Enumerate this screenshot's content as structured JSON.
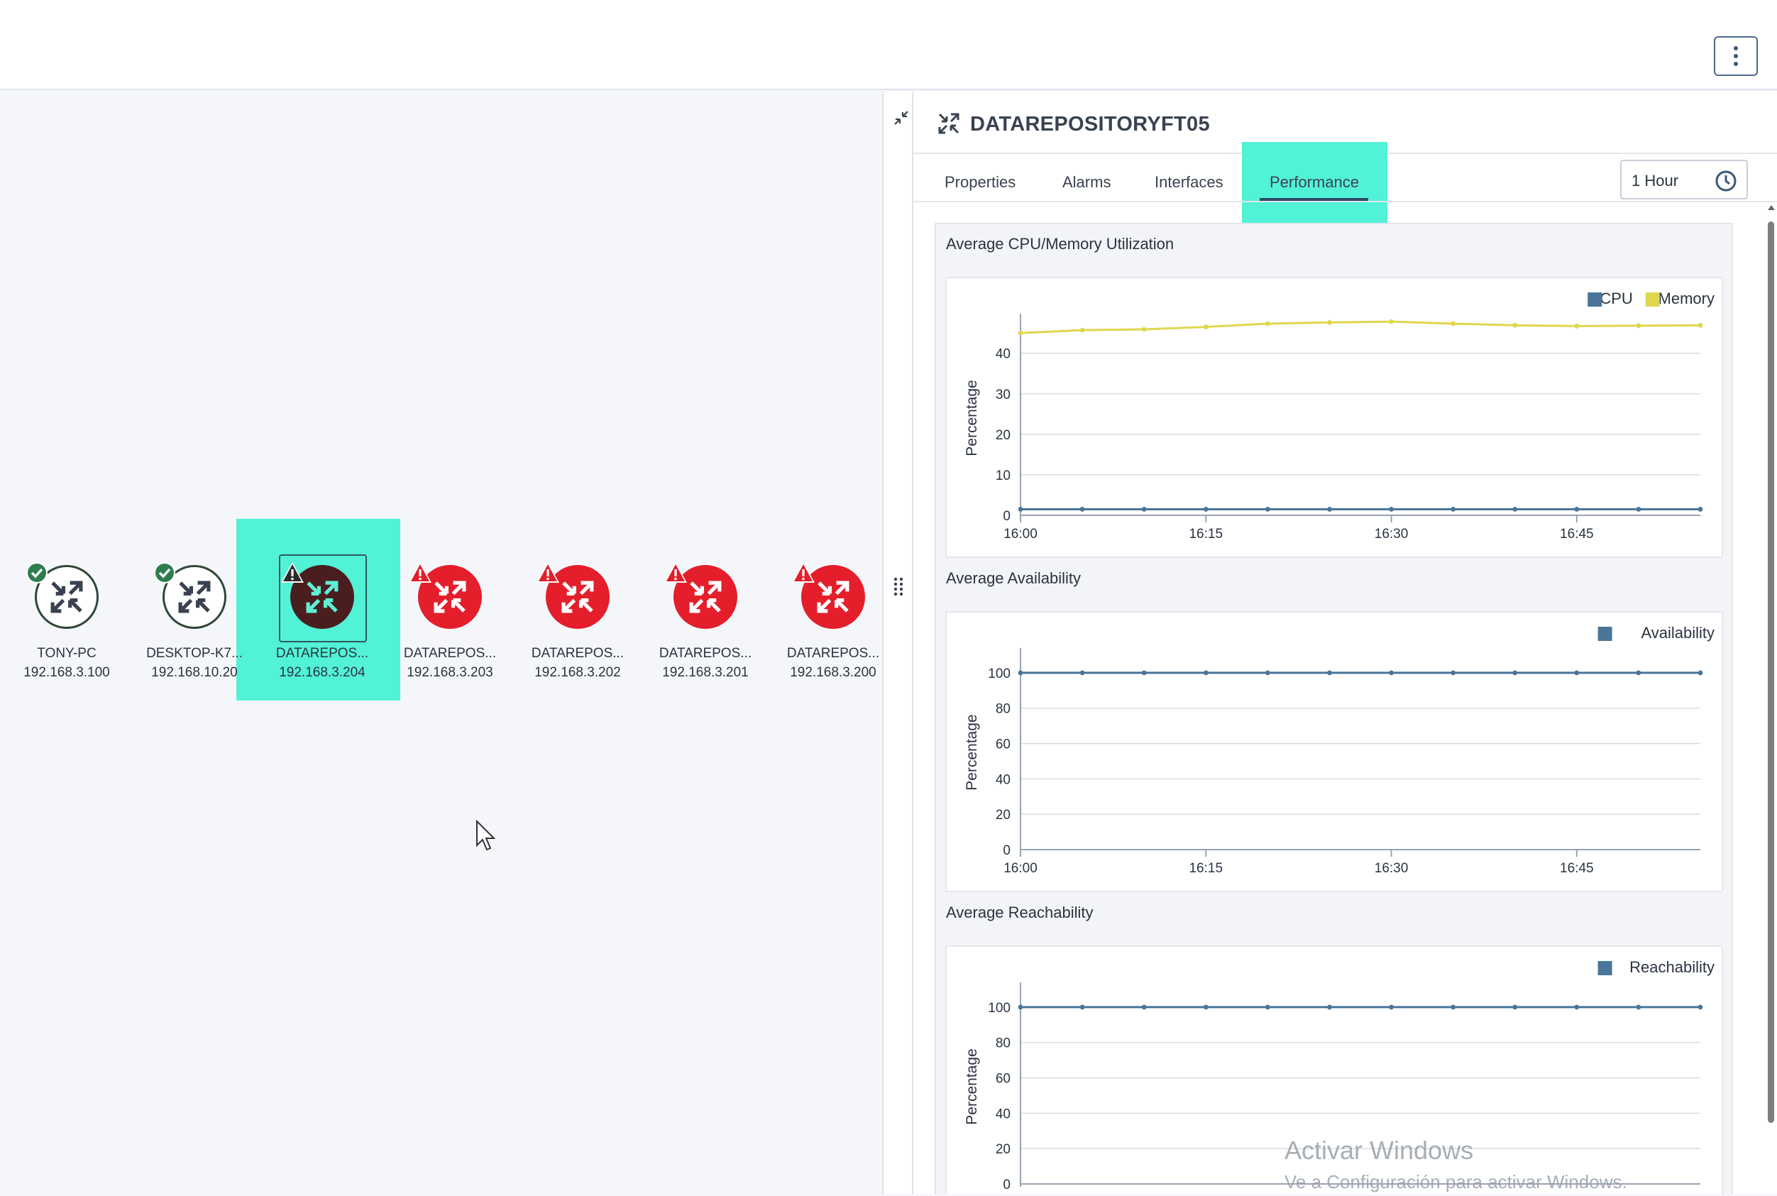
{
  "topbar": {
    "menu_icon": "kebab-vertical-icon"
  },
  "map": {
    "nodes": [
      {
        "name": "TONY-PC",
        "ip": "192.168.3.100",
        "status": "ok"
      },
      {
        "name": "DESKTOP-K7...",
        "ip": "192.168.10.20",
        "status": "ok"
      },
      {
        "name": "DATAREPOS...",
        "ip": "192.168.3.204",
        "status": "selected"
      },
      {
        "name": "DATAREPOS...",
        "ip": "192.168.3.203",
        "status": "error"
      },
      {
        "name": "DATAREPOS...",
        "ip": "192.168.3.202",
        "status": "error"
      },
      {
        "name": "DATAREPOS...",
        "ip": "192.168.3.201",
        "status": "error"
      },
      {
        "name": "DATAREPOS...",
        "ip": "192.168.3.200",
        "status": "error"
      }
    ],
    "colors": {
      "ok_badge": "#2e7d4f",
      "error": "#e41e2b",
      "selected_highlight": "#52f2d6"
    }
  },
  "panel": {
    "title": "DATAREPOSITORYFT05",
    "tabs": [
      {
        "label": "Properties"
      },
      {
        "label": "Alarms"
      },
      {
        "label": "Interfaces"
      },
      {
        "label": "Performance",
        "active": true
      }
    ],
    "time_range": "1 Hour",
    "sections": {
      "cpu_mem_title": "Average CPU/Memory Utilization",
      "availability_title": "Average Availability",
      "reachability_title": "Average Reachability"
    }
  },
  "chart_data": [
    {
      "type": "line",
      "title": "Average CPU/Memory Utilization",
      "ylabel": "Percentage",
      "ylim": [
        0,
        48
      ],
      "yticks": [
        0,
        10,
        20,
        30,
        40
      ],
      "x_labels": [
        "16:00",
        "16:15",
        "16:30",
        "16:45"
      ],
      "x": [
        "16:00",
        "16:05",
        "16:10",
        "16:15",
        "16:20",
        "16:25",
        "16:30",
        "16:35",
        "16:40",
        "16:45",
        "16:50",
        "16:55"
      ],
      "legend": "top-right",
      "series": [
        {
          "name": "CPU",
          "color": "#4a7598",
          "values": [
            1.5,
            1.5,
            1.5,
            1.5,
            1.5,
            1.5,
            1.5,
            1.5,
            1.5,
            1.5,
            1.5,
            1.5
          ]
        },
        {
          "name": "Memory",
          "color": "#e0d74e",
          "values": [
            45,
            45.7,
            45.9,
            46.5,
            47.3,
            47.6,
            47.8,
            47.3,
            46.9,
            46.7,
            46.8,
            46.9
          ]
        }
      ]
    },
    {
      "type": "line",
      "title": "Average Availability",
      "ylabel": "Percentage",
      "ylim": [
        0,
        110
      ],
      "yticks": [
        0,
        20,
        40,
        60,
        80,
        100
      ],
      "x_labels": [
        "16:00",
        "16:15",
        "16:30",
        "16:45"
      ],
      "x": [
        "16:00",
        "16:05",
        "16:10",
        "16:15",
        "16:20",
        "16:25",
        "16:30",
        "16:35",
        "16:40",
        "16:45",
        "16:50",
        "16:55"
      ],
      "legend": "top-right",
      "series": [
        {
          "name": "Availability",
          "color": "#4a7598",
          "values": [
            100,
            100,
            100,
            100,
            100,
            100,
            100,
            100,
            100,
            100,
            100,
            100
          ]
        }
      ]
    },
    {
      "type": "line",
      "title": "Average Reachability",
      "ylabel": "Percentage",
      "ylim": [
        0,
        110
      ],
      "yticks": [
        0,
        20,
        40,
        60,
        80,
        100
      ],
      "x_labels": [],
      "x": [
        "16:00",
        "16:05",
        "16:10",
        "16:15",
        "16:20",
        "16:25",
        "16:30",
        "16:35",
        "16:40",
        "16:45",
        "16:50",
        "16:55"
      ],
      "legend": "top-right",
      "series": [
        {
          "name": "Reachability",
          "color": "#4a7598",
          "values": [
            100,
            100,
            100,
            100,
            100,
            100,
            100,
            100,
            100,
            100,
            100,
            100
          ]
        }
      ]
    }
  ],
  "watermark": {
    "line1": "Activar Windows",
    "line2": "Ve a Configuración para activar Windows."
  }
}
